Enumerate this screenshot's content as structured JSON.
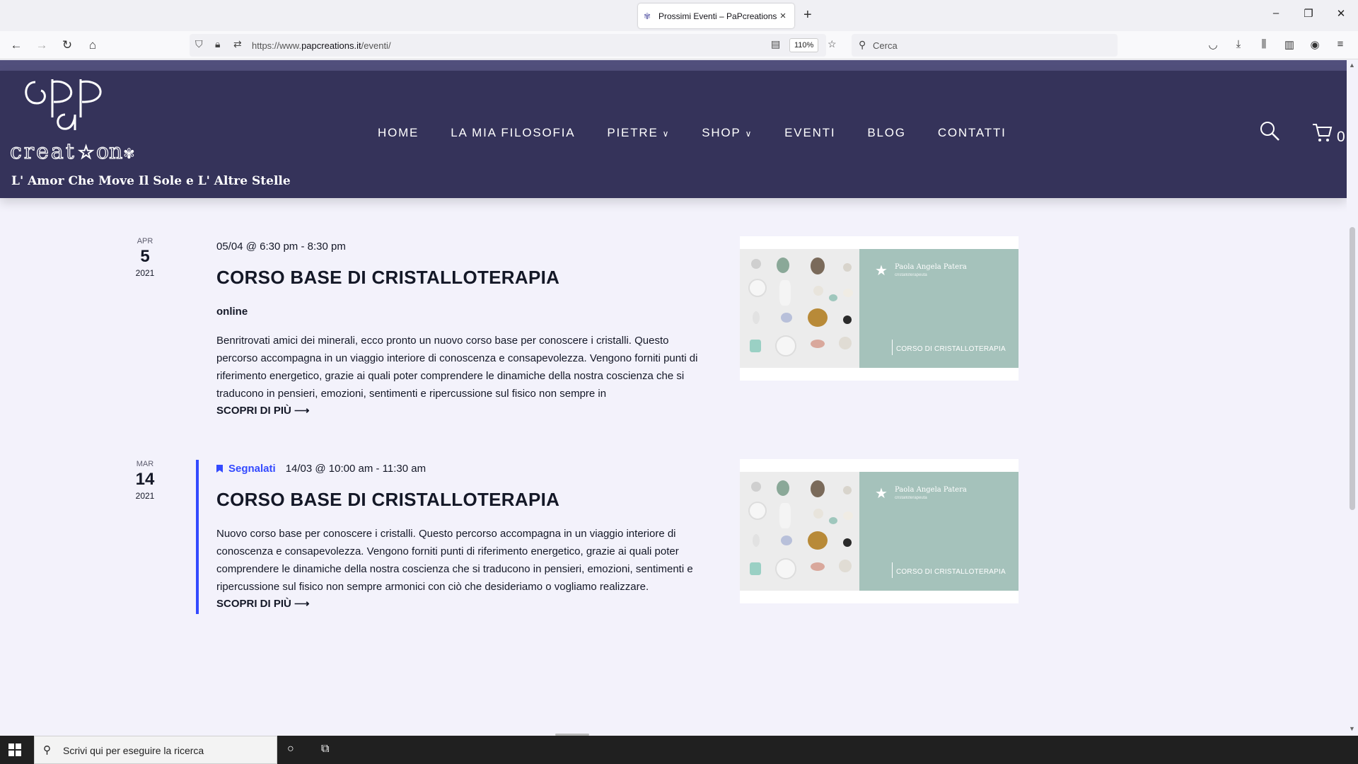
{
  "browser": {
    "tab_title": "Prossimi Eventi – PaPcreations",
    "url_prefix": "https://www.",
    "url_domain": "papcreations.it",
    "url_path": "/eventi/",
    "zoom": "110%",
    "search_placeholder": "Cerca"
  },
  "site": {
    "tagline": "L' Amor Che Move Il Sole e L' Altre Stelle",
    "logo_text": "PaP creations",
    "menu": [
      {
        "label": "HOME"
      },
      {
        "label": "LA MIA FILOSOFIA"
      },
      {
        "label": "PIETRE",
        "dropdown": true
      },
      {
        "label": "SHOP",
        "dropdown": true
      },
      {
        "label": "EVENTI"
      },
      {
        "label": "BLOG"
      },
      {
        "label": "CONTATTI"
      }
    ],
    "cart_count": "0",
    "brand_color": "#35335a",
    "accent_color": "#334aff"
  },
  "events": [
    {
      "month": "APR",
      "day": "5",
      "year": "2021",
      "featured_label": "",
      "datetime": "05/04 @ 6:30 pm - 8:30 pm",
      "title": "CORSO BASE DI CRISTALLOTERAPIA",
      "venue": "online",
      "description": "Benritrovati amici dei minerali, ecco pronto un nuovo corso base per conoscere i cristalli. Questo percorso accompagna in un viaggio interiore di conoscenza e consapevolezza. Vengono forniti punti di riferimento energetico, grazie ai quali poter comprendere le dinamiche della nostra coscienza che si traducono in pensieri, emozioni, sentimenti e ripercussione sul fisico non sempre in",
      "more": "SCOPRI DI PIÙ ⟶",
      "image": {
        "name": "Paola Angela Patera",
        "sub": "cristalloterapeuta",
        "caption": "CORSO DI CRISTALLOTERAPIA"
      }
    },
    {
      "month": "MAR",
      "day": "14",
      "year": "2021",
      "featured_label": "Segnalati",
      "datetime": "14/03 @ 10:00 am - 11:30 am",
      "title": "CORSO BASE DI CRISTALLOTERAPIA",
      "venue": "",
      "description": "Nuovo corso base per conoscere i cristalli. Questo percorso accompagna in un viaggio interiore di conoscenza e consapevolezza. Vengono forniti punti di riferimento energetico, grazie ai quali poter comprendere le dinamiche della nostra coscienza che si traducono in pensieri, emozioni, sentimenti e ripercussione sul fisico non sempre armonici con ciò che desideriamo o vogliamo realizzare.",
      "more": "SCOPRI DI PIÙ ⟶",
      "image": {
        "name": "Paola Angela Patera",
        "sub": "cristalloterapeuta",
        "caption": "CORSO DI CRISTALLOTERAPIA"
      }
    }
  ],
  "taskbar": {
    "search_placeholder": "Scrivi qui per eseguire la ricerca"
  }
}
